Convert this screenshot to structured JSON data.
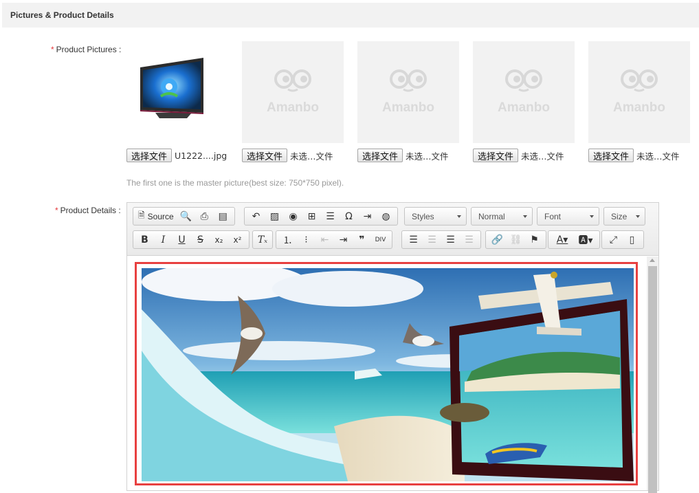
{
  "section": {
    "title": "Pictures & Product Details"
  },
  "pictures": {
    "label": "Product Pictures :",
    "required_mark": "*",
    "placeholder_logo": "Amanbo",
    "slots": [
      {
        "button": "选择文件",
        "file": "U1222....jpg"
      },
      {
        "button": "选择文件",
        "file": "未选…文件"
      },
      {
        "button": "选择文件",
        "file": "未选…文件"
      },
      {
        "button": "选择文件",
        "file": "未选…文件"
      },
      {
        "button": "选择文件",
        "file": "未选…文件"
      }
    ],
    "hint": "The first one is the master picture(best size: 750*750 pixel)."
  },
  "details": {
    "label": "Product Details :",
    "required_mark": "*",
    "toolbar": {
      "source_label": "Source",
      "styles": "Styles",
      "format": "Normal",
      "font": "Font",
      "size": "Size"
    }
  },
  "colors": {
    "accent_red": "#e4393c",
    "frame_red": "#e84040",
    "header_bg": "#f2f2f2"
  }
}
